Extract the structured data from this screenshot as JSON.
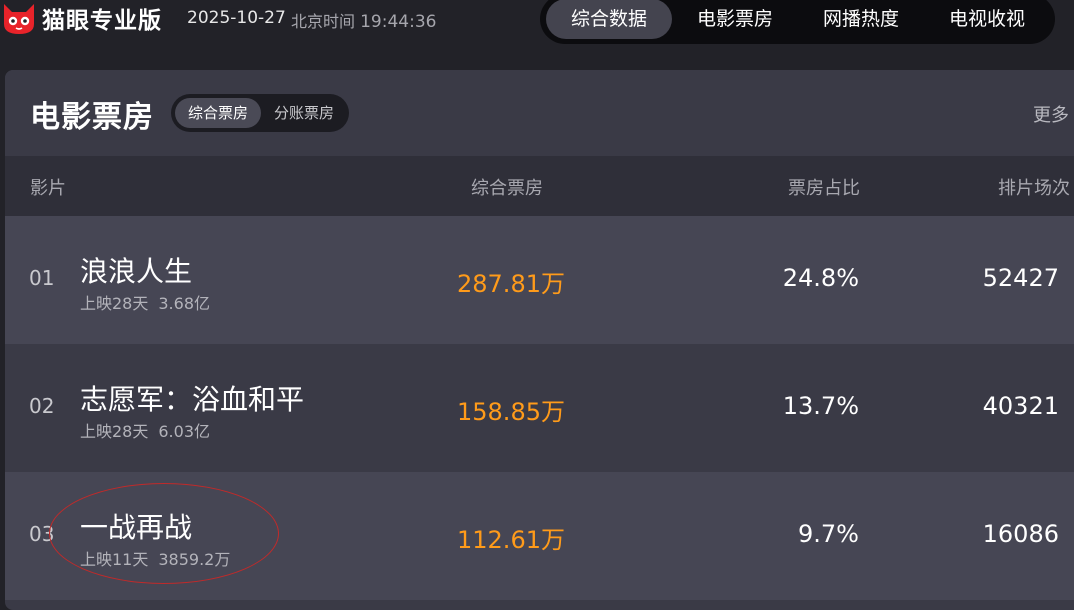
{
  "header": {
    "app_name": "猫眼专业版",
    "date": "2025-10-27",
    "time_label": "北京时间",
    "time": "19:44:36",
    "tabs": [
      {
        "label": "综合数据",
        "active": true
      },
      {
        "label": "电影票房",
        "active": false
      },
      {
        "label": "网播热度",
        "active": false
      },
      {
        "label": "电视收视",
        "active": false
      }
    ]
  },
  "panel": {
    "title": "电影票房",
    "segments": [
      {
        "label": "综合票房",
        "active": true
      },
      {
        "label": "分账票房",
        "active": false
      }
    ],
    "more_label": "更多",
    "columns": [
      "影片",
      "综合票房",
      "票房占比",
      "排片场次"
    ],
    "rows": [
      {
        "rank": "01",
        "name": "浪浪人生",
        "days": "上映28天",
        "total": "3.68亿",
        "box_office": "287.81万",
        "ratio": "24.8%",
        "shows": "52427"
      },
      {
        "rank": "02",
        "name": "志愿军：浴血和平",
        "days": "上映28天",
        "total": "6.03亿",
        "box_office": "158.85万",
        "ratio": "13.7%",
        "shows": "40321"
      },
      {
        "rank": "03",
        "name": "一战再战",
        "days": "上映11天",
        "total": "3859.2万",
        "box_office": "112.61万",
        "ratio": "9.7%",
        "shows": "16086"
      }
    ]
  },
  "colors": {
    "accent_orange": "#ff9b1a",
    "annotation_red": "#c02a2a",
    "logo_red": "#e8232a"
  },
  "icons": {
    "logo": "maoyan-cat-icon"
  }
}
